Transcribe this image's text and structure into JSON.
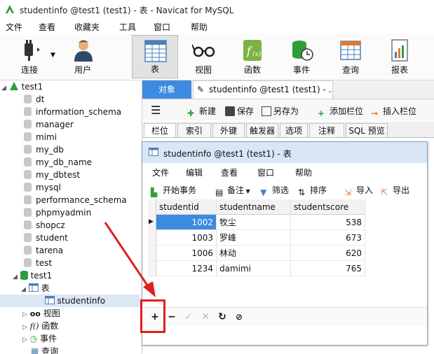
{
  "window": {
    "title": "studentinfo @test1 (test1) - 表 - Navicat for MySQL"
  },
  "menubar": [
    "文件",
    "查看",
    "收藏夹",
    "工具",
    "窗口",
    "帮助"
  ],
  "toolbar": [
    {
      "label": "连接",
      "icon": "plug-icon"
    },
    {
      "label": "用户",
      "icon": "user-icon"
    },
    {
      "label": "表",
      "icon": "table-icon",
      "selected": true
    },
    {
      "label": "视图",
      "icon": "glasses-icon"
    },
    {
      "label": "函数",
      "icon": "function-icon"
    },
    {
      "label": "事件",
      "icon": "event-icon"
    },
    {
      "label": "查询",
      "icon": "query-icon"
    },
    {
      "label": "报表",
      "icon": "report-icon"
    }
  ],
  "tree": {
    "connection": "test1",
    "databases": [
      "dt",
      "information_schema",
      "manager",
      "mimi",
      "my_db",
      "my_db_name",
      "my_dbtest",
      "mysql",
      "performance_schema",
      "phpmyadmin",
      "shopcz",
      "student",
      "tarena",
      "test"
    ],
    "open_db": "test1",
    "tables_label": "表",
    "selected_table": "studentinfo",
    "views_label": "视图",
    "functions_label": "函数",
    "events_label": "事件",
    "queries_label": "查询"
  },
  "tabs": {
    "objects": "对象",
    "document": "studentinfo @test1 (test1) - ..."
  },
  "design_toolbar": {
    "new": "新建",
    "save": "保存",
    "save_as": "另存为",
    "add_field": "添加栏位",
    "insert_field": "插入栏位"
  },
  "field_tabs": [
    "栏位",
    "索引",
    "外键",
    "触发器",
    "选项",
    "注释",
    "SQL 预览"
  ],
  "inner": {
    "title": "studentinfo @test1 (test1) - 表",
    "menu": [
      "文件",
      "编辑",
      "查看",
      "窗口",
      "帮助"
    ],
    "tools": {
      "begin_tx": "开始事务",
      "note": "备注",
      "filter": "筛选",
      "sort": "排序",
      "import": "导入",
      "export": "导出"
    },
    "columns": [
      "studentid",
      "studentname",
      "studentscore"
    ],
    "rows": [
      [
        "1002",
        "牧尘",
        "538"
      ],
      [
        "1003",
        "罗峰",
        "673"
      ],
      [
        "1006",
        "林动",
        "620"
      ],
      [
        "1234",
        "damimi",
        "765"
      ]
    ],
    "nav_icons": [
      "plus-icon",
      "minus-icon",
      "check-icon",
      "cancel-icon",
      "refresh-icon",
      "stop-icon"
    ]
  },
  "colors": {
    "selection": "#3d8be0",
    "highlight_box": "#e02020",
    "arrow": "#e02020"
  }
}
